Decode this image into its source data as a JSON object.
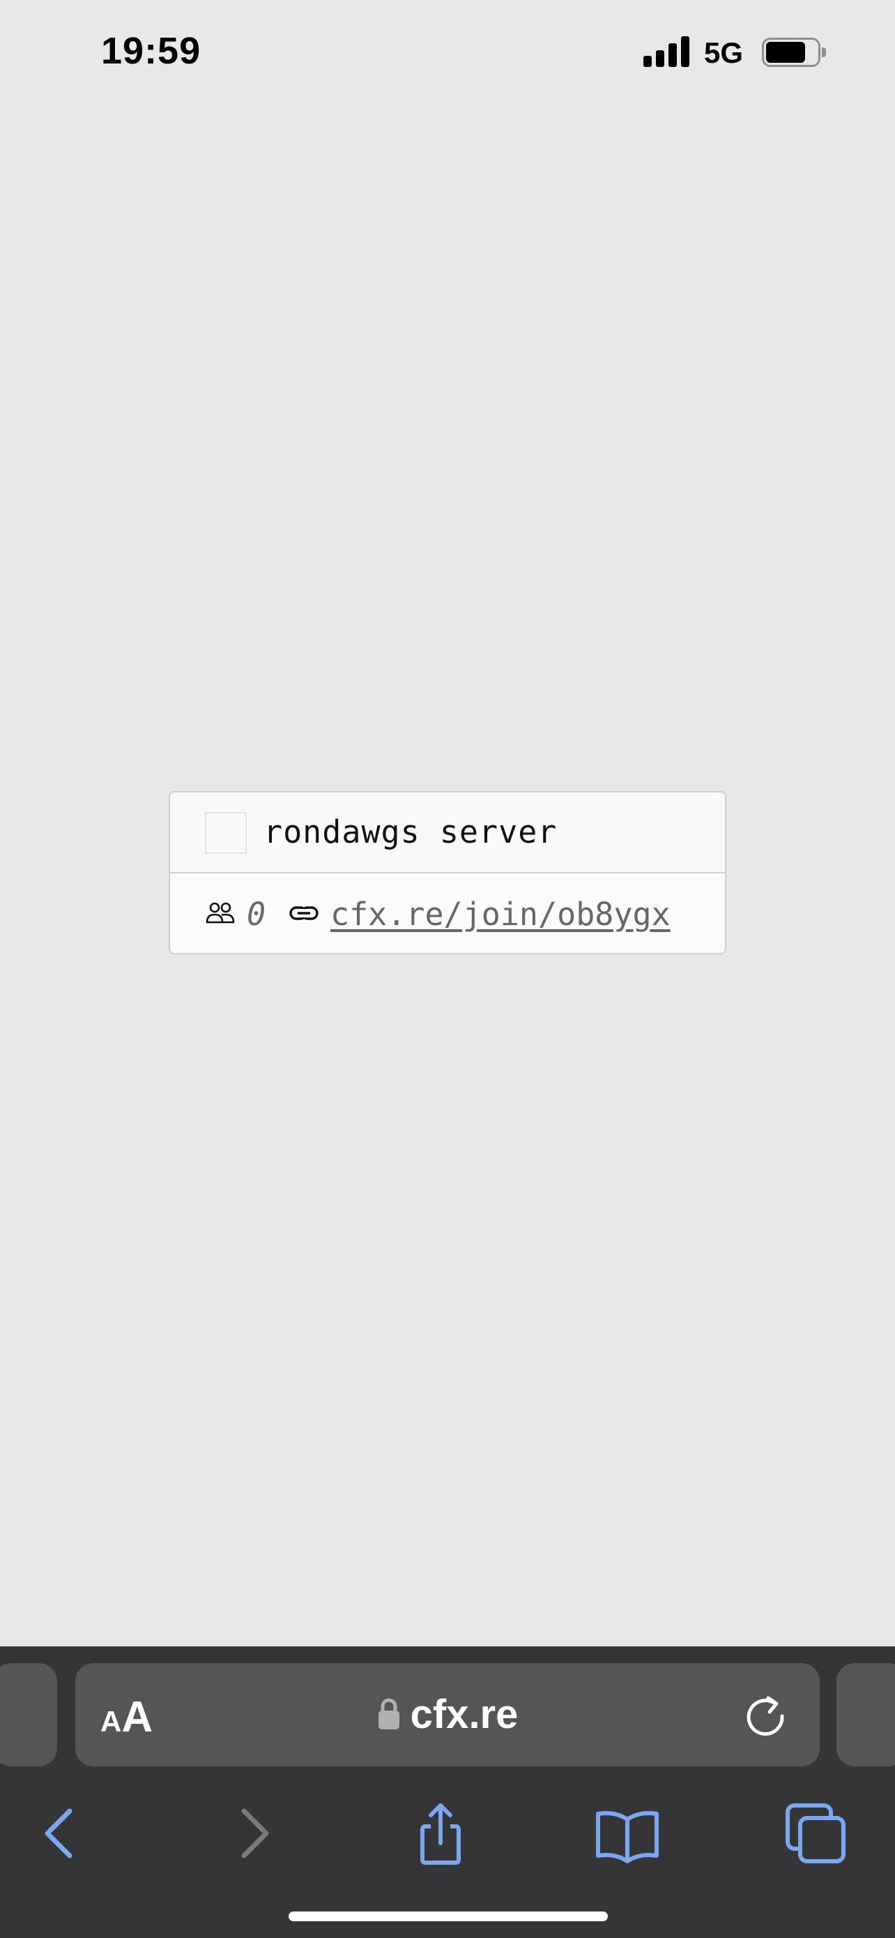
{
  "status_bar": {
    "time": "19:59",
    "network": "5G"
  },
  "server_card": {
    "name": "rondawgs server",
    "player_count": "0",
    "join_link": "cfx.re/join/ob8ygx"
  },
  "safari": {
    "text_size_small": "A",
    "text_size_large": "A",
    "url": "cfx.re",
    "accent_color": "#7aa7f0"
  }
}
